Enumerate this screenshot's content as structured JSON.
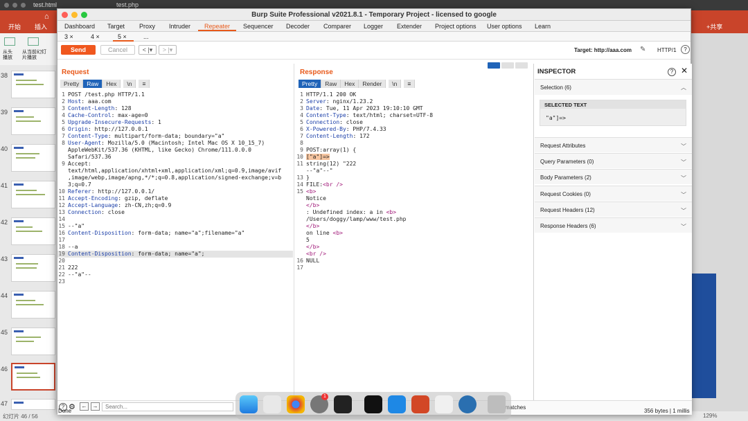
{
  "bg_app": {
    "tabs": [
      "test.html",
      "test.php"
    ],
    "menu": [
      "开始",
      "插入"
    ],
    "share": "共享",
    "ribbon_labels": [
      "从头播放",
      "从当前幻灯片播放"
    ],
    "slide_numbers": [
      "38",
      "39",
      "40",
      "41",
      "42",
      "43",
      "44",
      "45",
      "46",
      "47"
    ],
    "status_left": "幻灯片 46 / 56",
    "status_zoom": "129%"
  },
  "window": {
    "title": "Burp Suite Professional v2021.8.1 - Temporary Project - licensed to google"
  },
  "main_tabs": [
    "Dashboard",
    "Target",
    "Proxy",
    "Intruder",
    "Repeater",
    "Sequencer",
    "Decoder",
    "Comparer",
    "Logger",
    "Extender",
    "Project options",
    "User options",
    "Learn"
  ],
  "sub_tabs": [
    "3 ×",
    "4 ×",
    "5 ×",
    "..."
  ],
  "toolbar": {
    "send": "Send",
    "cancel": "Cancel",
    "back": "< |▾",
    "forward": "> |▾",
    "target": "Target: http://aaa.com",
    "protocol": "HTTP/1"
  },
  "request": {
    "title": "Request",
    "view_buttons": [
      "Pretty",
      "Raw",
      "Hex",
      "\\n",
      "≡"
    ],
    "lines": [
      [
        "1",
        "POST /test.php HTTP/1.1"
      ],
      [
        "2",
        "Host: aaa.com"
      ],
      [
        "3",
        "Content-Length: 128"
      ],
      [
        "4",
        "Cache-Control: max-age=0"
      ],
      [
        "5",
        "Upgrade-Insecure-Requests: 1"
      ],
      [
        "6",
        "Origin: http://127.0.0.1"
      ],
      [
        "7",
        "Content-Type: multipart/form-data; boundary=\"a\""
      ],
      [
        "8",
        "User-Agent: Mozilla/5.0 (Macintosh; Intel Mac OS X 10_15_7)"
      ],
      [
        "",
        "AppleWebKit/537.36 (KHTML, like Gecko) Chrome/111.0.0.0"
      ],
      [
        "",
        "Safari/537.36"
      ],
      [
        "9",
        "Accept:"
      ],
      [
        "",
        "text/html,application/xhtml+xml,application/xml;q=0.9,image/avif"
      ],
      [
        "",
        ",image/webp,image/apng,*/*;q=0.8,application/signed-exchange;v=b"
      ],
      [
        "",
        "3;q=0.7"
      ],
      [
        "10",
        "Referer: http://127.0.0.1/"
      ],
      [
        "11",
        "Accept-Encoding: gzip, deflate"
      ],
      [
        "12",
        "Accept-Language: zh-CN,zh;q=0.9"
      ],
      [
        "13",
        "Connection: close"
      ],
      [
        "14",
        ""
      ],
      [
        "15",
        "--\"a\""
      ],
      [
        "16",
        "Content-Disposition: form-data; name=\"a\";filename=\"a\""
      ],
      [
        "17",
        ""
      ],
      [
        "18",
        "--a"
      ],
      [
        "19",
        "Content-Disposition: form-data; name=\"a\";"
      ],
      [
        "20",
        ""
      ],
      [
        "21",
        "222"
      ],
      [
        "22",
        "--\"a\"--"
      ],
      [
        "23",
        ""
      ]
    ]
  },
  "response": {
    "title": "Response",
    "view_buttons": [
      "Pretty",
      "Raw",
      "Hex",
      "Render",
      "\\n",
      "≡"
    ],
    "lines": [
      [
        "1",
        "HTTP/1.1 200 OK"
      ],
      [
        "2",
        "Server: nginx/1.23.2"
      ],
      [
        "3",
        "Date: Tue, 11 Apr 2023 19:10:10 GMT"
      ],
      [
        "4",
        "Content-Type: text/html; charset=UTF-8"
      ],
      [
        "5",
        "Connection: close"
      ],
      [
        "6",
        "X-Powered-By: PHP/7.4.33"
      ],
      [
        "7",
        "Content-Length: 172"
      ],
      [
        "8",
        ""
      ],
      [
        "9",
        "POST:array(1) {"
      ],
      [
        "10",
        "[\"a\"]=>"
      ],
      [
        "11",
        "string(12) \"222"
      ],
      [
        "",
        "--\"a\"--\""
      ],
      [
        "13",
        "}"
      ],
      [
        "14",
        "FILE:<br />"
      ],
      [
        "15",
        "<b>"
      ],
      [
        "",
        "  Notice"
      ],
      [
        "",
        "</b>"
      ],
      [
        "",
        ":  Undefined index: a in <b>"
      ],
      [
        "",
        "  /Users/doggy/lamp/www/test.php"
      ],
      [
        "",
        "</b>"
      ],
      [
        "",
        " on line <b>"
      ],
      [
        "",
        "  5"
      ],
      [
        "",
        "</b>"
      ],
      [
        "",
        "<br />"
      ],
      [
        "16",
        "NULL"
      ],
      [
        "17",
        ""
      ]
    ]
  },
  "inspector": {
    "title": "INSPECTOR",
    "selection": "Selection (6)",
    "selected_text_label": "SELECTED TEXT",
    "selected_text": "\"a\"]=>",
    "sections": [
      "Request Attributes",
      "Query Parameters (0)",
      "Body Parameters (2)",
      "Request Cookies (0)",
      "Request Headers (12)",
      "Response Headers (6)"
    ]
  },
  "footer": {
    "search_placeholder": "Search...",
    "matches": "matches",
    "status": "Done",
    "size": "356 bytes | 1 millis"
  },
  "colors": {
    "accent": "#f0571e",
    "view_active": "#1f63b8",
    "key_blue": "#1a3ea8",
    "tag_purple": "#a01878"
  }
}
